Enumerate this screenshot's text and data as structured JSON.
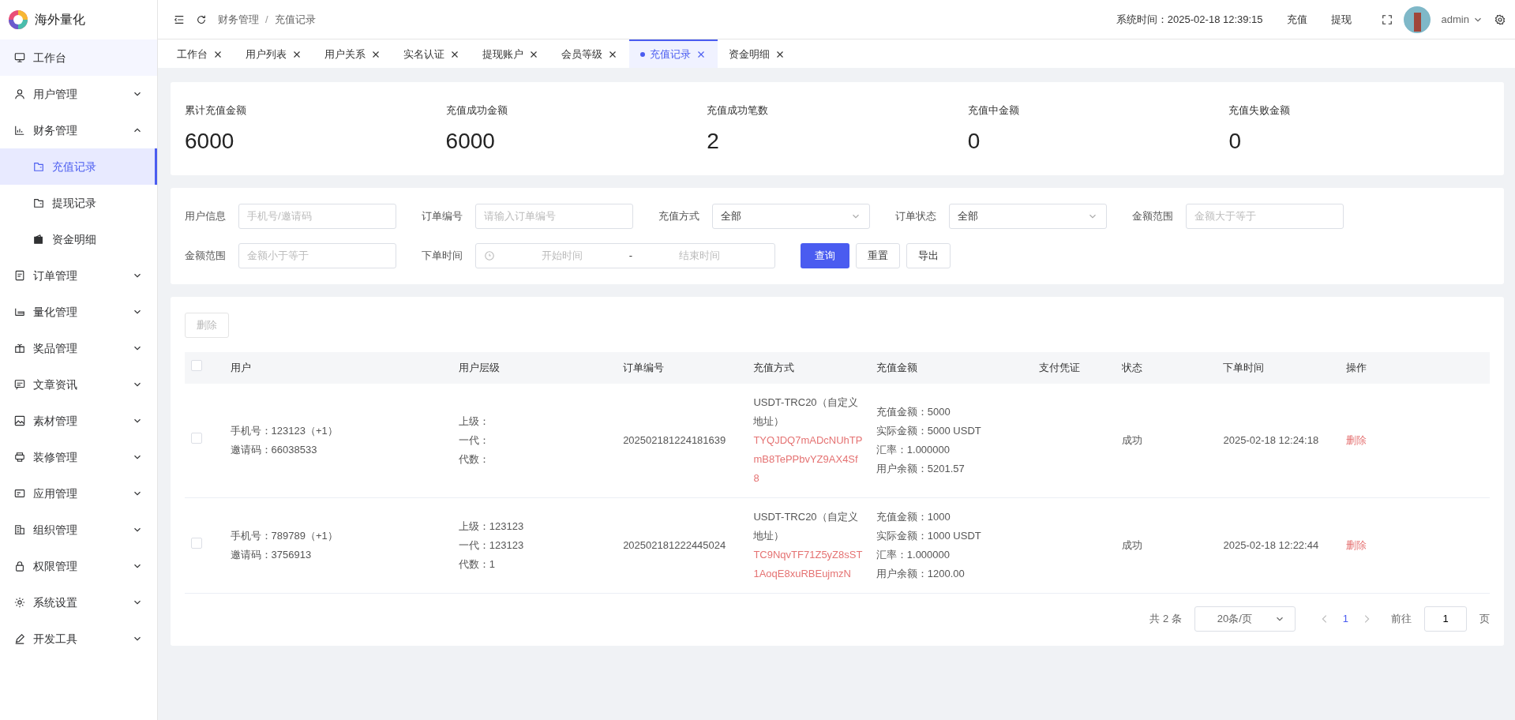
{
  "brand": {
    "title": "海外量化"
  },
  "sidebar": {
    "items": [
      {
        "label": "工作台",
        "kind": "link",
        "selected": false
      },
      {
        "label": "用户管理",
        "kind": "group",
        "expanded": false
      },
      {
        "label": "财务管理",
        "kind": "group",
        "expanded": true,
        "children": [
          {
            "label": "充值记录",
            "selected": true
          },
          {
            "label": "提现记录",
            "selected": false
          },
          {
            "label": "资金明细",
            "selected": false
          }
        ]
      },
      {
        "label": "订单管理",
        "kind": "group",
        "expanded": false
      },
      {
        "label": "量化管理",
        "kind": "group",
        "expanded": false
      },
      {
        "label": "奖品管理",
        "kind": "group",
        "expanded": false
      },
      {
        "label": "文章资讯",
        "kind": "group",
        "expanded": false
      },
      {
        "label": "素材管理",
        "kind": "group",
        "expanded": false
      },
      {
        "label": "装修管理",
        "kind": "group",
        "expanded": false
      },
      {
        "label": "应用管理",
        "kind": "group",
        "expanded": false
      },
      {
        "label": "组织管理",
        "kind": "group",
        "expanded": false
      },
      {
        "label": "权限管理",
        "kind": "group",
        "expanded": false
      },
      {
        "label": "系统设置",
        "kind": "group",
        "expanded": false
      },
      {
        "label": "开发工具",
        "kind": "group",
        "expanded": false
      }
    ]
  },
  "header": {
    "breadcrumb": [
      "财务管理",
      "充值记录"
    ],
    "separator": "/",
    "system_time": "系统时间：2025-02-18 12:39:15",
    "links": [
      "充值",
      "提现"
    ],
    "user": "admin"
  },
  "tabs": [
    {
      "label": "工作台",
      "selected": false
    },
    {
      "label": "用户列表",
      "selected": false
    },
    {
      "label": "用户关系",
      "selected": false
    },
    {
      "label": "实名认证",
      "selected": false
    },
    {
      "label": "提现账户",
      "selected": false
    },
    {
      "label": "会员等级",
      "selected": false
    },
    {
      "label": "充值记录",
      "selected": true
    },
    {
      "label": "资金明细",
      "selected": false
    }
  ],
  "stats": [
    {
      "label": "累计充值金额",
      "value": "6000"
    },
    {
      "label": "充值成功金额",
      "value": "6000"
    },
    {
      "label": "充值成功笔数",
      "value": "2"
    },
    {
      "label": "充值中金额",
      "value": "0"
    },
    {
      "label": "充值失败金额",
      "value": "0"
    }
  ],
  "filters": [
    {
      "label": "用户信息",
      "kind": "input",
      "placeholder": "手机号/邀请码"
    },
    {
      "label": "订单编号",
      "kind": "input",
      "placeholder": "请输入订单编号"
    },
    {
      "label": "充值方式",
      "kind": "select",
      "value": "全部"
    },
    {
      "label": "订单状态",
      "kind": "select",
      "value": "全部"
    },
    {
      "label": "金额范围",
      "kind": "input",
      "placeholder": "金额大于等于"
    },
    {
      "label": "金额范围",
      "kind": "input",
      "placeholder": "金额小于等于"
    },
    {
      "label": "下单时间",
      "kind": "daterange",
      "start_placeholder": "开始时间",
      "separator": "-",
      "end_placeholder": "结束时间"
    }
  ],
  "filter_buttons": [
    {
      "label": "查询",
      "kind": "primary"
    },
    {
      "label": "重置",
      "kind": "default"
    },
    {
      "label": "导出",
      "kind": "default"
    }
  ],
  "table": {
    "delete_button": {
      "label": "删除",
      "disabled": true
    },
    "header_checked": false,
    "columns": [
      "用户",
      "用户层级",
      "订单编号",
      "充值方式",
      "充值金额",
      "支付凭证",
      "状态",
      "下单时间",
      "操作"
    ],
    "rows": [
      {
        "checked": false,
        "user": [
          "手机号：123123（+1）",
          "邀请码：66038533"
        ],
        "level": [
          "上级：",
          "一代：",
          "代数："
        ],
        "order_no": "202502181224181639",
        "method": "USDT-TRC20（自定义地址）",
        "address": "TYQJDQ7mADcNUhTPmB8TePPbvYZ9AX4Sf8",
        "amount": [
          "充值金额：5000",
          "实际金额：5000 USDT",
          "汇率：1.000000",
          "用户余额：5201.57"
        ],
        "status": "成功",
        "time": "2025-02-18 12:24:18",
        "action": "删除"
      },
      {
        "checked": false,
        "user": [
          "手机号：789789（+1）",
          "邀请码：3756913"
        ],
        "level": [
          "上级：123123",
          "一代：123123",
          "代数：1"
        ],
        "order_no": "202502181222445024",
        "method": "USDT-TRC20（自定义地址）",
        "address": "TC9NqvTF71Z5yZ8sST1AoqE8xuRBEujmzN",
        "amount": [
          "充值金额：1000",
          "实际金额：1000 USDT",
          "汇率：1.000000",
          "用户余额：1200.00"
        ],
        "status": "成功",
        "time": "2025-02-18 12:22:44",
        "action": "删除"
      }
    ]
  },
  "pagination": {
    "total": "共 2 条",
    "page_size": "20条/页",
    "pages": [
      {
        "label": "1",
        "selected": true
      }
    ],
    "goto_label": "前往",
    "goto_value": "1",
    "goto_suffix": "页"
  }
}
